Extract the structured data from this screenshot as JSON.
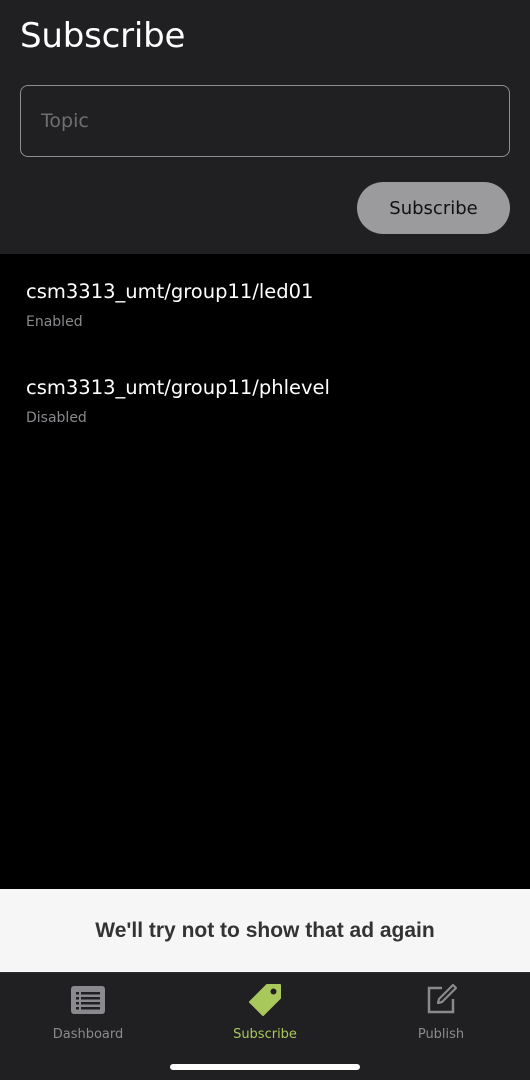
{
  "header": {
    "title": "Subscribe",
    "topic_placeholder": "Topic",
    "topic_value": "",
    "subscribe_label": "Subscribe"
  },
  "subscriptions": [
    {
      "topic": "csm3313_umt/group11/led01",
      "status": "Enabled"
    },
    {
      "topic": "csm3313_umt/group11/phlevel",
      "status": "Disabled"
    }
  ],
  "ad_notice": {
    "text": "We'll try not to show that ad again"
  },
  "tabbar": {
    "tabs": [
      {
        "label": "Dashboard",
        "icon": "list-icon",
        "active": false
      },
      {
        "label": "Subscribe",
        "icon": "tag-icon",
        "active": true
      },
      {
        "label": "Publish",
        "icon": "edit-icon",
        "active": false
      }
    ]
  },
  "colors": {
    "accent": "#a8c85c",
    "header_bg": "#202022",
    "button_bg": "#9b9b9e"
  }
}
